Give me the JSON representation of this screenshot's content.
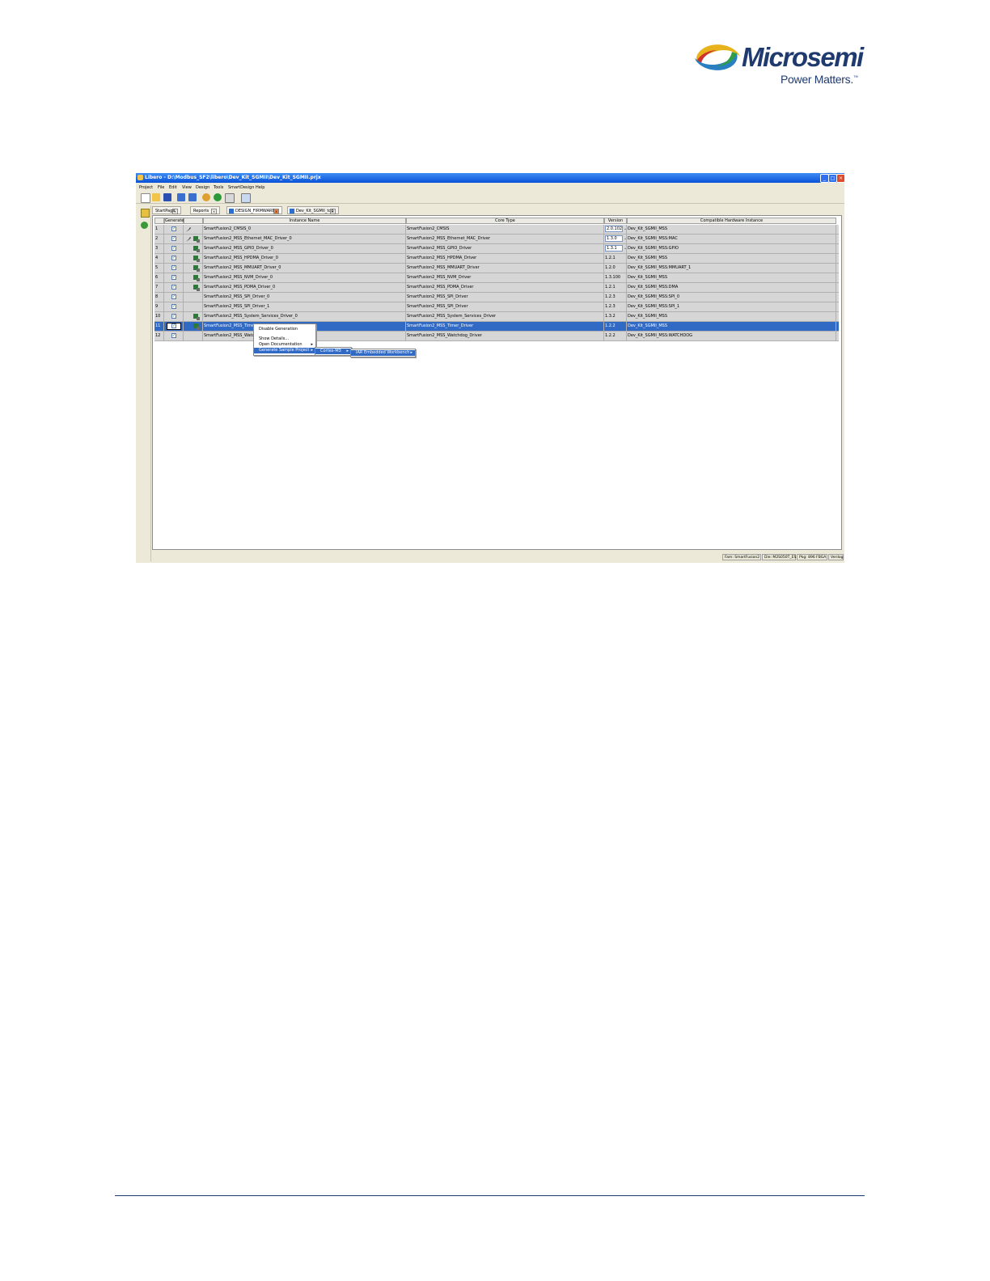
{
  "logo": {
    "brand": "Microsemi",
    "tagline": "Power Matters.",
    "tm": "™"
  },
  "window": {
    "title": "Libero - D:\\Modbus_SF2\\libero\\Dev_Kit_SGMII\\Dev_Kit_SGMII.prjx",
    "controls": {
      "minimize": "_",
      "maximize": "□",
      "close": "×"
    },
    "menu": [
      "Project",
      "File",
      "Edit",
      "View",
      "Design",
      "Tools",
      "SmartDesign",
      "Help"
    ],
    "tabs": [
      {
        "label": "StartPage"
      },
      {
        "label": "Reports"
      },
      {
        "label": "DESIGN_FIRMWARE"
      },
      {
        "label": "Dev_Kit_SGMII_top"
      }
    ],
    "columns": [
      "Generate",
      "Instance Name",
      "Core Type",
      "Version",
      "Compatible Hardware Instance"
    ],
    "rows": [
      {
        "n": "1",
        "instance": "SmartFusion2_CMSIS_0",
        "core": "SmartFusion2_CMSIS",
        "version": "2.0.102",
        "hw": "Dev_Kit_SGMII_MSS",
        "checked": true,
        "icon": "tool-icon",
        "dropdown": true
      },
      {
        "n": "2",
        "instance": "SmartFusion2_MSS_Ethernet_MAC_Driver_0",
        "core": "SmartFusion2_MSS_Ethernet_MAC_Driver",
        "version": "1.3.0",
        "hw": "Dev_Kit_SGMII_MSS:MAC",
        "checked": true,
        "icon": "tool-chip-icon",
        "dropdown": true
      },
      {
        "n": "3",
        "instance": "SmartFusion2_MSS_GPIO_Driver_0",
        "core": "SmartFusion2_MSS_GPIO_Driver",
        "version": "1.3.1",
        "hw": "Dev_Kit_SGMII_MSS:GPIO",
        "checked": true,
        "icon": "chip-icon",
        "dropdown": true
      },
      {
        "n": "4",
        "instance": "SmartFusion2_MSS_HPDMA_Driver_0",
        "core": "SmartFusion2_MSS_HPDMA_Driver",
        "version": "1.2.1",
        "hw": "Dev_Kit_SGMII_MSS",
        "checked": true,
        "icon": "chip-icon",
        "dropdown": false
      },
      {
        "n": "5",
        "instance": "SmartFusion2_MSS_MMUART_Driver_0",
        "core": "SmartFusion2_MSS_MMUART_Driver",
        "version": "1.2.0",
        "hw": "Dev_Kit_SGMII_MSS:MMUART_1",
        "checked": true,
        "icon": "chip-icon",
        "dropdown": false
      },
      {
        "n": "6",
        "instance": "SmartFusion2_MSS_NVM_Driver_0",
        "core": "SmartFusion2_MSS_NVM_Driver",
        "version": "1.3.100",
        "hw": "Dev_Kit_SGMII_MSS",
        "checked": true,
        "icon": "chip-icon",
        "dropdown": false
      },
      {
        "n": "7",
        "instance": "SmartFusion2_MSS_PDMA_Driver_0",
        "core": "SmartFusion2_MSS_PDMA_Driver",
        "version": "1.2.1",
        "hw": "Dev_Kit_SGMII_MSS:DMA",
        "checked": true,
        "icon": "chip-icon",
        "dropdown": false
      },
      {
        "n": "8",
        "instance": "SmartFusion2_MSS_SPI_Driver_0",
        "core": "SmartFusion2_MSS_SPI_Driver",
        "version": "1.2.3",
        "hw": "Dev_Kit_SGMII_MSS:SPI_0",
        "checked": true,
        "icon": "",
        "dropdown": false
      },
      {
        "n": "9",
        "instance": "SmartFusion2_MSS_SPI_Driver_1",
        "core": "SmartFusion2_MSS_SPI_Driver",
        "version": "1.2.3",
        "hw": "Dev_Kit_SGMII_MSS:SPI_1",
        "checked": true,
        "icon": "",
        "dropdown": false
      },
      {
        "n": "10",
        "instance": "SmartFusion2_MSS_System_Services_Driver_0",
        "core": "SmartFusion2_MSS_System_Services_Driver",
        "version": "1.3.2",
        "hw": "Dev_Kit_SGMII_MSS",
        "checked": true,
        "icon": "chip-icon",
        "dropdown": false
      },
      {
        "n": "11",
        "instance": "SmartFusion2_MSS_Timer_Driver_0",
        "core": "SmartFusion2_MSS_Timer_Driver",
        "version": "1.2.2",
        "hw": "Dev_Kit_SGMII_MSS",
        "checked": true,
        "icon": "chip-icon",
        "dropdown": false,
        "selected": true
      },
      {
        "n": "12",
        "instance": "SmartFusion2_MSS_Watchdog_Driver_0",
        "core": "SmartFusion2_MSS_Watchdog_Driver",
        "version": "1.2.2",
        "hw": "Dev_Kit_SGMII_MSS:WATCHDOG",
        "checked": true,
        "icon": "",
        "dropdown": false
      }
    ],
    "context_menu": [
      {
        "label": "Disable Generation",
        "arrow": ""
      },
      {
        "label": "Show Details...",
        "arrow": ""
      },
      {
        "label": "Open Documentation",
        "arrow": "▸"
      },
      {
        "label": "Generate Sample Project",
        "arrow": "▸"
      }
    ],
    "submenu_1": {
      "label": "Cortex-M3",
      "arrow": "▸"
    },
    "submenu_2": {
      "label": "IAR Embedded Workbench",
      "arrow": "▸"
    },
    "status": [
      "Fam: SmartFusion2",
      "Die: M2S050T_ES",
      "Pkg: 896 FBGA",
      "Verilog"
    ],
    "checkmark": "✓"
  }
}
